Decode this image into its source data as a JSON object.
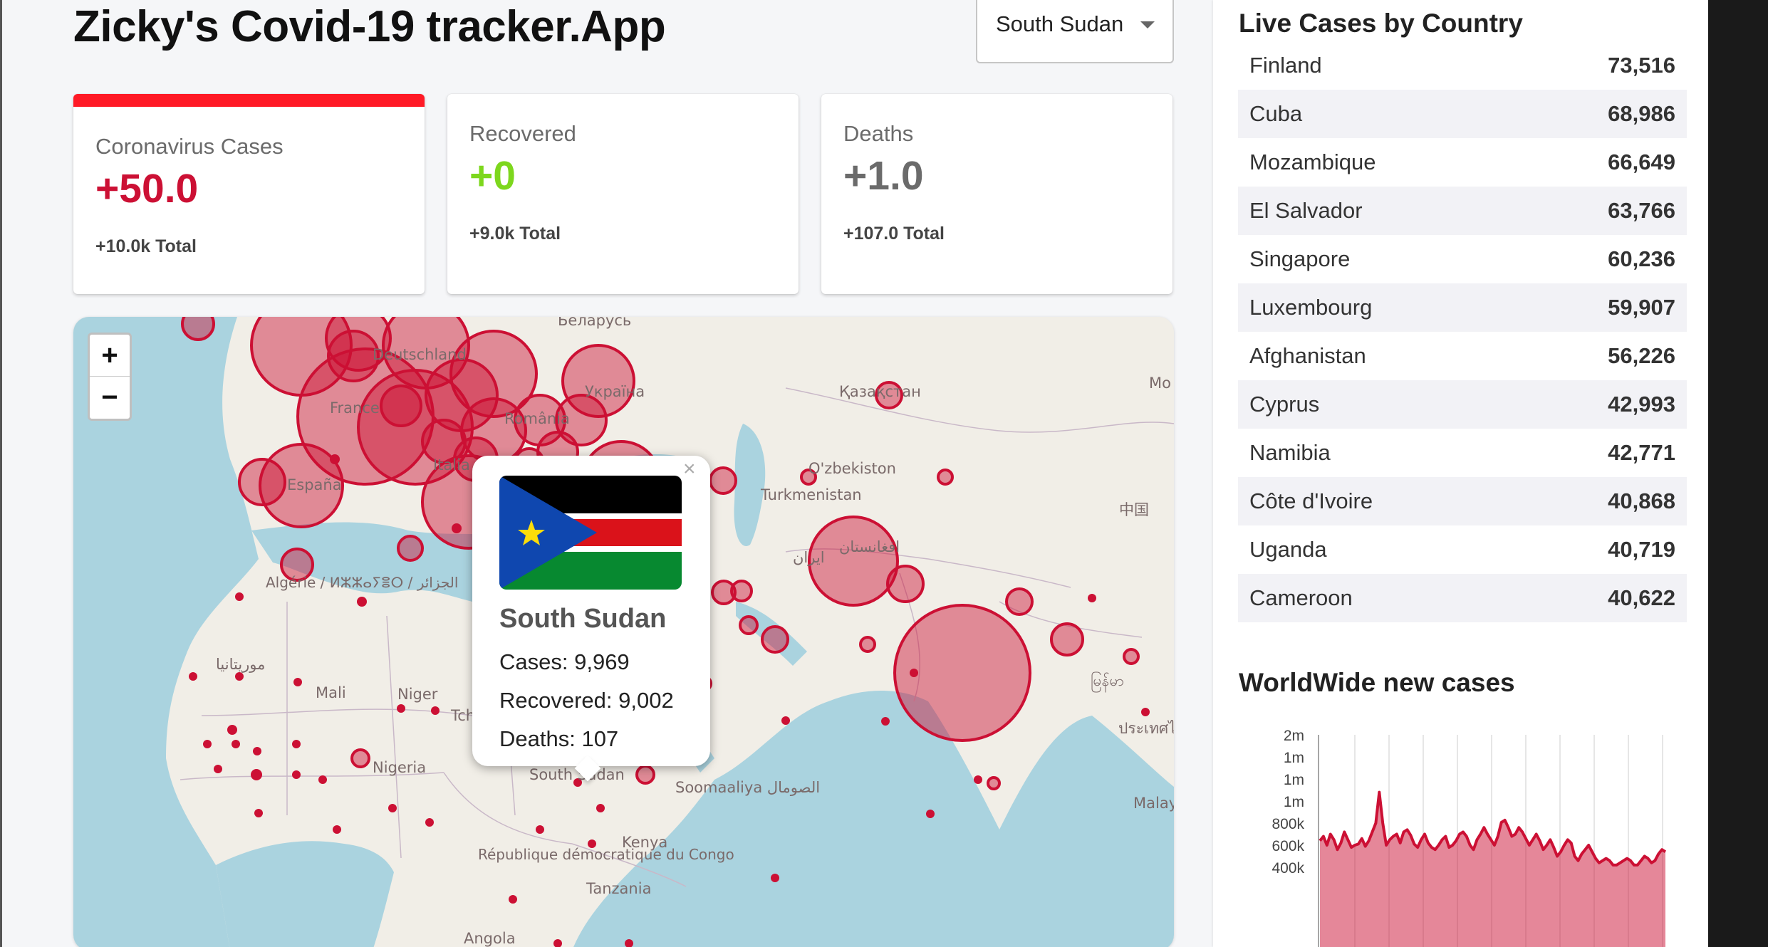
{
  "app": {
    "title": "Zicky's Covid-19 tracker.App"
  },
  "country_select": {
    "selected": "South Sudan",
    "icon": "chevron-down-icon"
  },
  "cards": [
    {
      "title": "Coronavirus Cases",
      "value": "+50.0",
      "total": "+10.0k Total",
      "value_color": "#cc1034",
      "active": true,
      "accent": "#ff1a26"
    },
    {
      "title": "Recovered",
      "value": "+0",
      "total": "+9.0k Total",
      "value_color": "#7dd71d"
    },
    {
      "title": "Deaths",
      "value": "+1.0",
      "total": "+107.0 Total",
      "value_color": "#6b6b6b"
    }
  ],
  "map": {
    "zoom_in": "+",
    "zoom_out": "−",
    "labels": [
      "Беларусь",
      "Deutschland",
      "Україна",
      "France",
      "România",
      "Қазақстан",
      "España",
      "Italia",
      "O'zbekiston",
      "Turkmenistan",
      "中国",
      "Algérie / ⵍⵣⵣⴰⵢⴻⵔ / الجزائر",
      "ایران",
      "افغانستان",
      "موريتانيا",
      "Mali",
      "Niger",
      "Tchad",
      "Nigeria",
      "South Sudan",
      "Soomaaliya الصومال",
      "Kenya",
      "République démocratique du Congo",
      "Tanzania",
      "Angola",
      "မြန်မာ",
      "ประเทศไทย",
      "Malay",
      "Mo улс"
    ],
    "circle_color": "#cc1034",
    "popup": {
      "close": "×",
      "country": "South Sudan",
      "cases": "Cases: 9,969",
      "recovered": "Recovered: 9,002",
      "deaths": "Deaths: 107"
    }
  },
  "live_cases": {
    "title": "Live Cases by Country",
    "rows": [
      {
        "country": "Finland",
        "cases": "73,516"
      },
      {
        "country": "Cuba",
        "cases": "68,986"
      },
      {
        "country": "Mozambique",
        "cases": "66,649"
      },
      {
        "country": "El Salvador",
        "cases": "63,766"
      },
      {
        "country": "Singapore",
        "cases": "60,236"
      },
      {
        "country": "Luxembourg",
        "cases": "59,907"
      },
      {
        "country": "Afghanistan",
        "cases": "56,226"
      },
      {
        "country": "Cyprus",
        "cases": "42,993"
      },
      {
        "country": "Namibia",
        "cases": "42,771"
      },
      {
        "country": "Côte d'Ivoire",
        "cases": "40,868"
      },
      {
        "country": "Uganda",
        "cases": "40,719"
      },
      {
        "country": "Cameroon",
        "cases": "40,622"
      }
    ]
  },
  "chart": {
    "title": "WorldWide new cases"
  },
  "chart_data": {
    "type": "area",
    "title": "WorldWide new cases",
    "y_tick_labels": [
      "2m",
      "1m",
      "1m",
      "1m",
      "800k",
      "600k",
      "400k"
    ],
    "y_ticks": [
      2000000,
      1800000,
      1600000,
      1400000,
      800000,
      600000,
      400000
    ],
    "ylim": [
      400000,
      2000000
    ],
    "series": [
      {
        "color": "#cc1034",
        "values": [
          640000,
          680000,
          600000,
          700000,
          650000,
          560000,
          620000,
          720000,
          650000,
          580000,
          600000,
          610000,
          660000,
          590000,
          640000,
          720000,
          800000,
          1480000,
          800000,
          600000,
          650000,
          680000,
          700000,
          620000,
          720000,
          740000,
          690000,
          610000,
          580000,
          650000,
          700000,
          620000,
          580000,
          560000,
          600000,
          650000,
          680000,
          580000,
          600000,
          640000,
          700000,
          720000,
          680000,
          600000,
          560000,
          650000,
          700000,
          760000,
          700000,
          650000,
          600000,
          680000,
          820000,
          880000,
          760000,
          680000,
          700000,
          760000,
          720000,
          660000,
          600000,
          650000,
          700000,
          640000,
          560000,
          600000,
          650000,
          580000,
          500000,
          540000,
          600000,
          650000,
          620000,
          500000,
          460000,
          520000,
          560000,
          600000,
          540000,
          480000,
          440000,
          460000,
          480000,
          460000,
          420000,
          420000,
          440000,
          460000,
          480000,
          460000,
          420000,
          420000,
          460000,
          500000,
          480000,
          440000,
          460000,
          520000,
          560000,
          540000
        ]
      }
    ],
    "grid": "vertical lines",
    "legend": "none"
  }
}
